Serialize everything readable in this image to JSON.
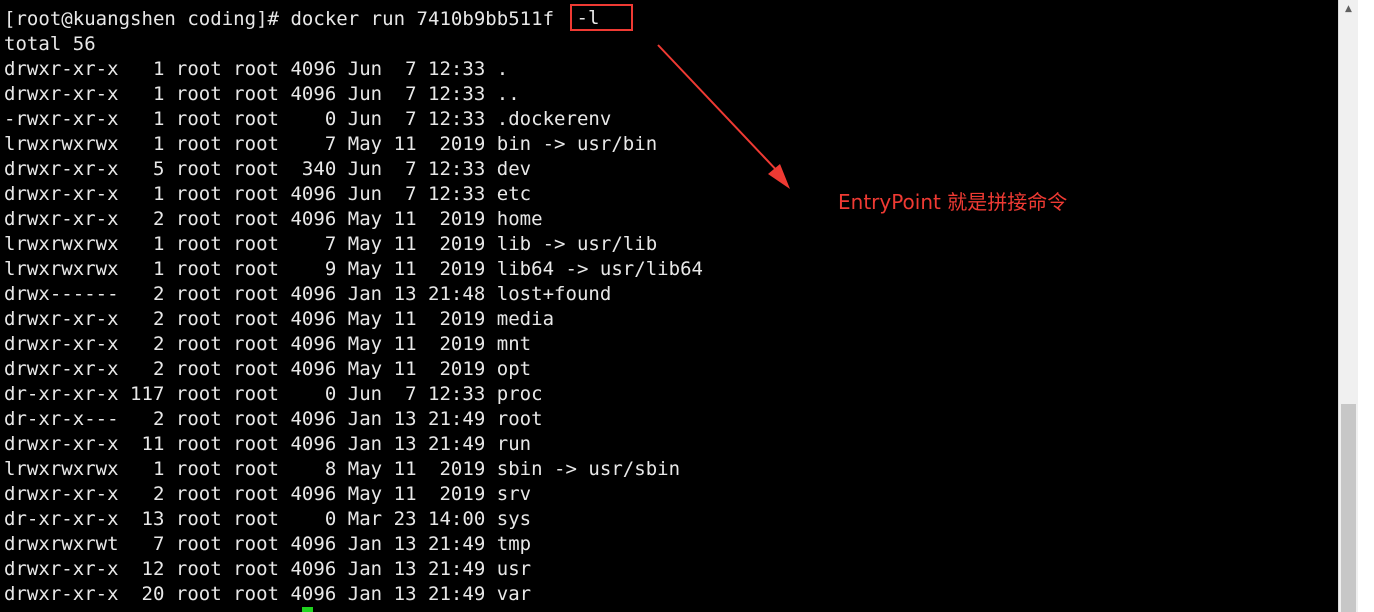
{
  "terminal": {
    "prompt": "[root@kuangshen coding]# docker run 7410b9bb511f ",
    "highlighted_arg": "-l",
    "output": [
      "total 56",
      "drwxr-xr-x   1 root root 4096 Jun  7 12:33 .",
      "drwxr-xr-x   1 root root 4096 Jun  7 12:33 ..",
      "-rwxr-xr-x   1 root root    0 Jun  7 12:33 .dockerenv",
      "lrwxrwxrwx   1 root root    7 May 11  2019 bin -> usr/bin",
      "drwxr-xr-x   5 root root  340 Jun  7 12:33 dev",
      "drwxr-xr-x   1 root root 4096 Jun  7 12:33 etc",
      "drwxr-xr-x   2 root root 4096 May 11  2019 home",
      "lrwxrwxrwx   1 root root    7 May 11  2019 lib -> usr/lib",
      "lrwxrwxrwx   1 root root    9 May 11  2019 lib64 -> usr/lib64",
      "drwx------   2 root root 4096 Jan 13 21:48 lost+found",
      "drwxr-xr-x   2 root root 4096 May 11  2019 media",
      "drwxr-xr-x   2 root root 4096 May 11  2019 mnt",
      "drwxr-xr-x   2 root root 4096 May 11  2019 opt",
      "dr-xr-xr-x 117 root root    0 Jun  7 12:33 proc",
      "dr-xr-x---   2 root root 4096 Jan 13 21:49 root",
      "drwxr-xr-x  11 root root 4096 Jan 13 21:49 run",
      "lrwxrwxrwx   1 root root    8 May 11  2019 sbin -> usr/sbin",
      "drwxr-xr-x   2 root root 4096 May 11  2019 srv",
      "dr-xr-xr-x  13 root root    0 Mar 23 14:00 sys",
      "drwxrwxrwt   7 root root 4096 Jan 13 21:49 tmp",
      "drwxr-xr-x  12 root root 4096 Jan 13 21:49 usr",
      "drwxr-xr-x  20 root root 4096 Jan 13 21:49 var"
    ]
  },
  "annotation": {
    "text": "EntryPoint 就是拼接命令",
    "color": "#ef3a33"
  },
  "colors": {
    "terminal_bg": "#000000",
    "terminal_fg": "#e8e8e8",
    "cursor": "#1fd31f",
    "annotation": "#ef3a33"
  },
  "scrollbar": {
    "icon": "triangle-up-icon"
  }
}
